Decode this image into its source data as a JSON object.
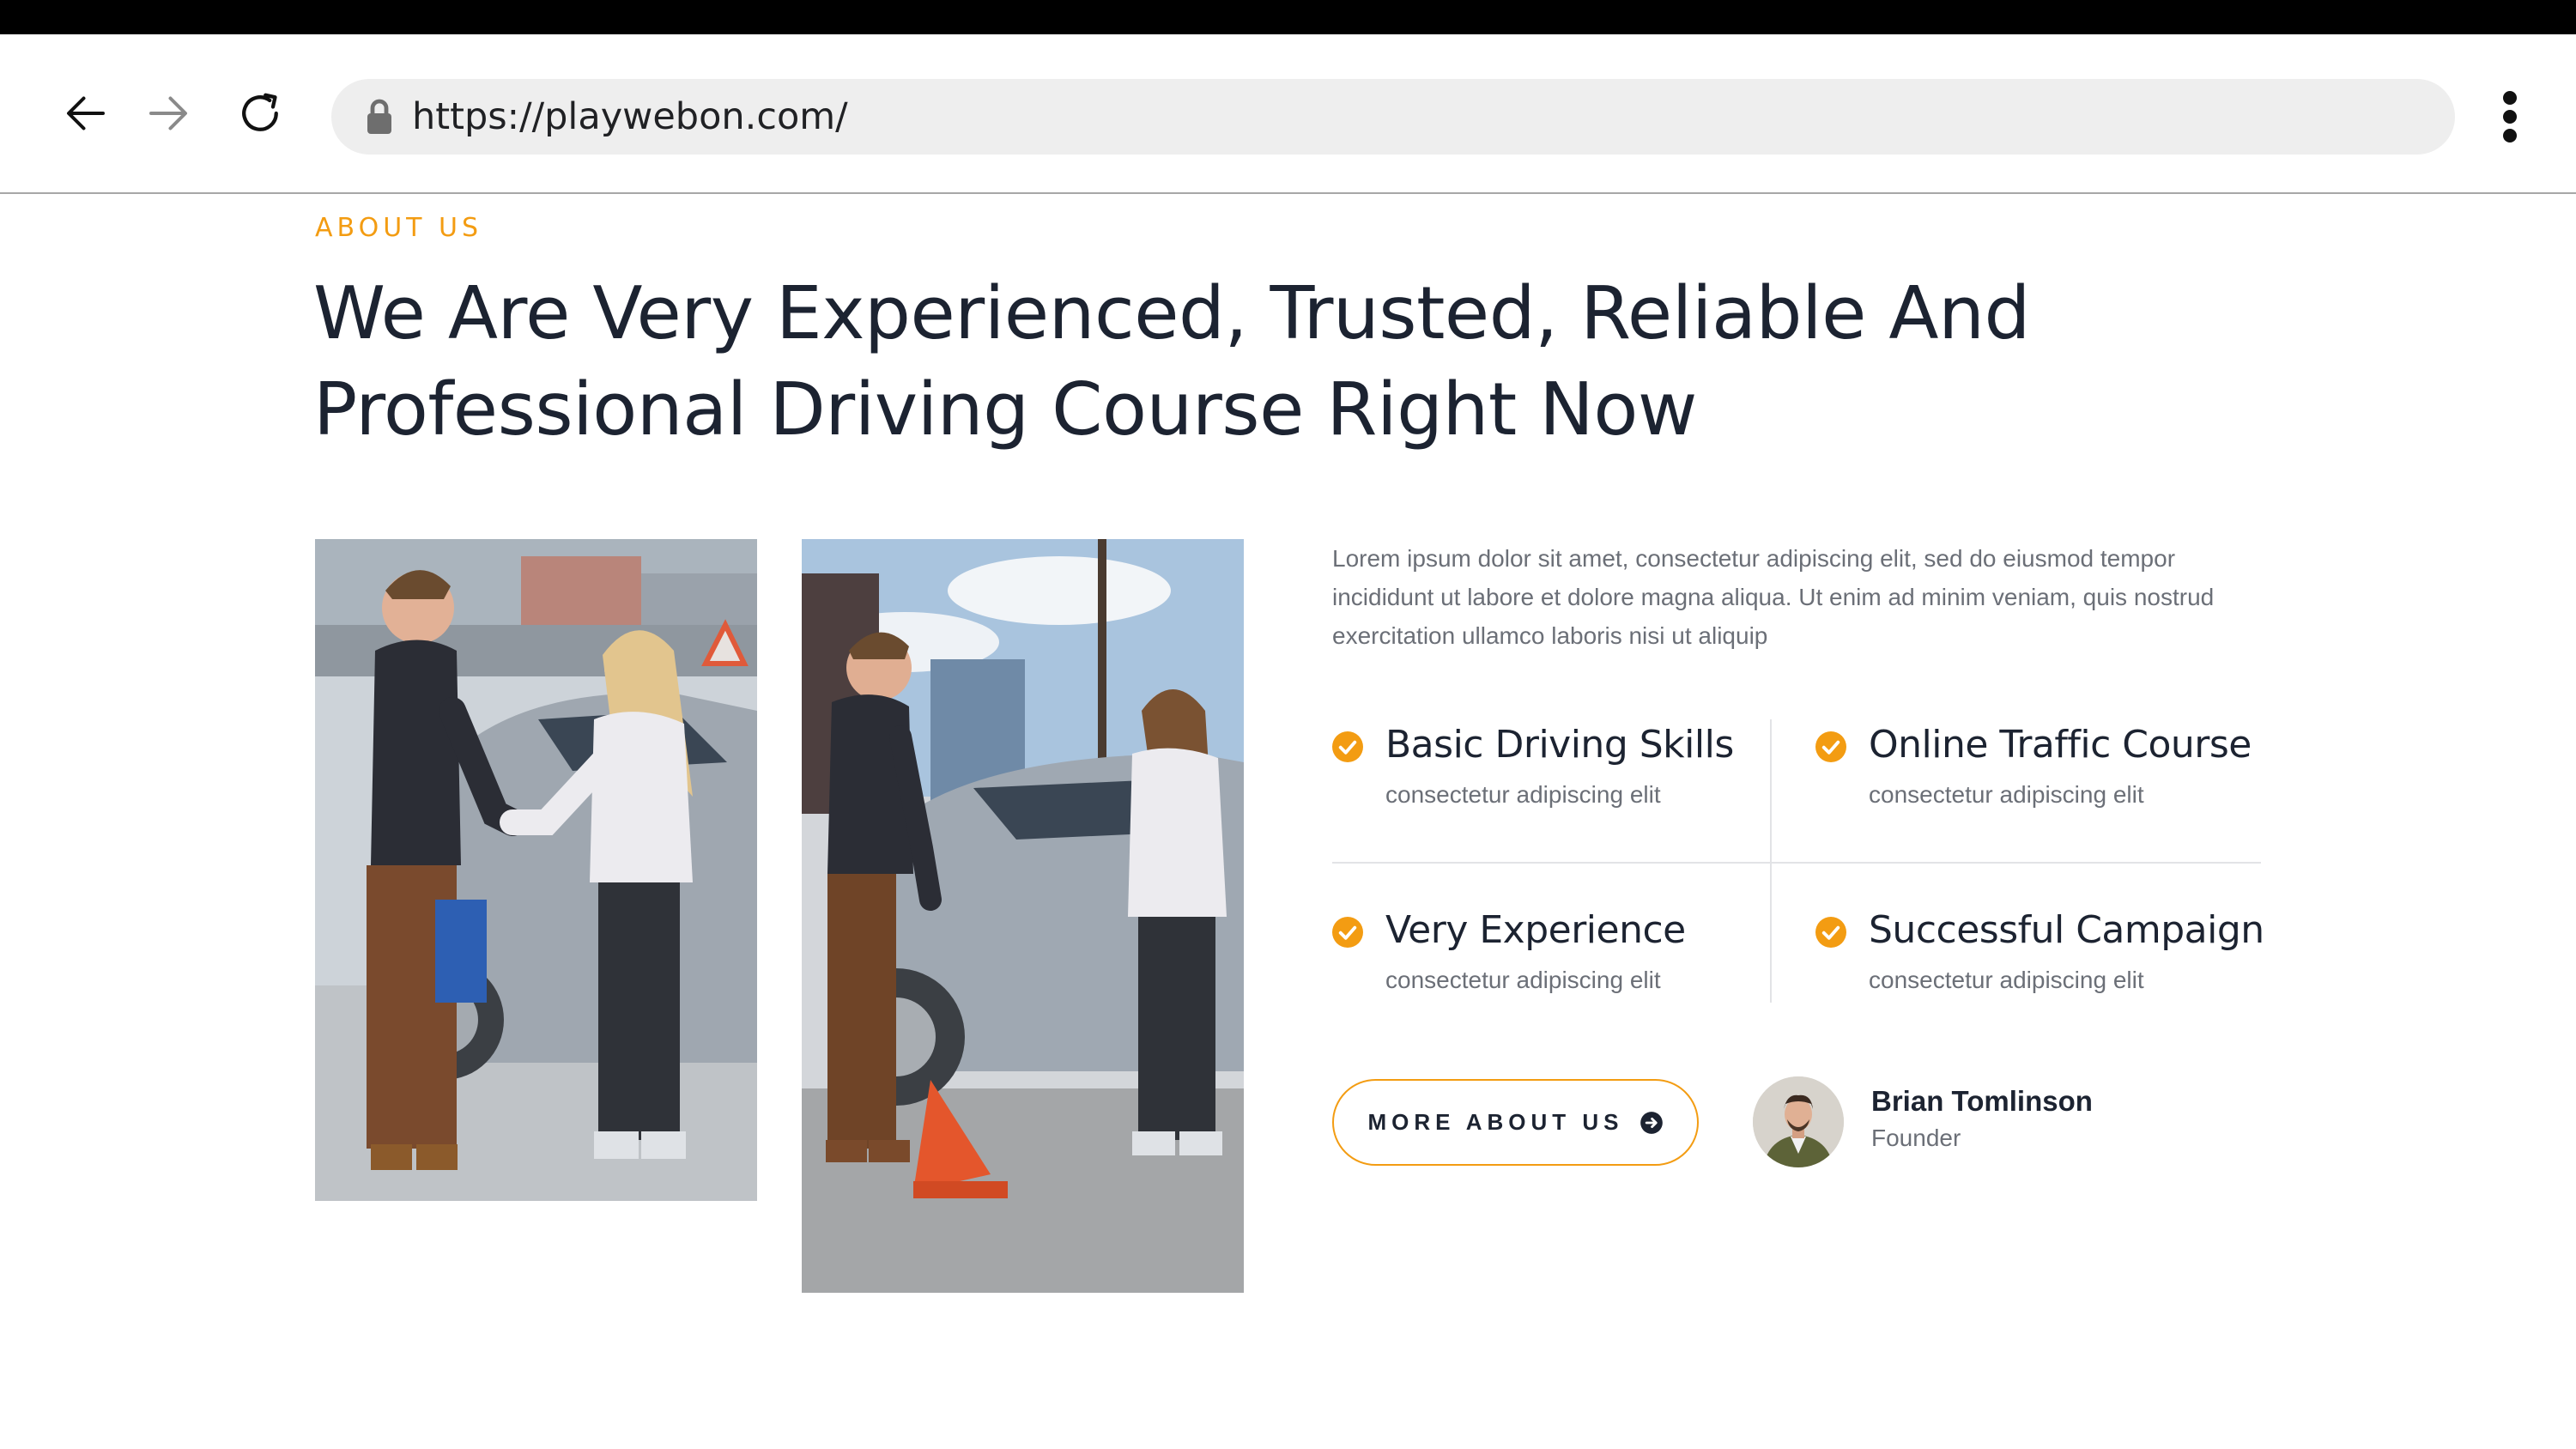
{
  "browser": {
    "url": "https://playwebon.com/",
    "icons": [
      "back-arrow-icon",
      "forward-arrow-icon",
      "reload-icon",
      "lock-icon",
      "more-vert-icon"
    ]
  },
  "about": {
    "eyebrow": "ABOUT US",
    "headline_line1": "We Are Very Experienced, Trusted, Reliable And",
    "headline_line2": "Professional Driving Course Right Now",
    "intro": "Lorem ipsum dolor sit amet, consectetur adipiscing elit, sed do eiusmod tempor incididunt ut labore et dolore magna aliqua. Ut enim ad minim veniam, quis nostrud exercitation ullamco laboris nisi ut aliquip",
    "features": [
      {
        "title": "Basic Driving Skills",
        "subtitle": "consectetur adipiscing elit"
      },
      {
        "title": "Online Traffic Course",
        "subtitle": "consectetur adipiscing elit"
      },
      {
        "title": "Very Experience",
        "subtitle": "consectetur adipiscing elit"
      },
      {
        "title": "Successful Campaign",
        "subtitle": "consectetur adipiscing elit"
      }
    ],
    "cta_label": "MORE ABOUT US",
    "person": {
      "name": "Brian Tomlinson",
      "role": "Founder"
    }
  },
  "colors": {
    "accent": "#f39c12",
    "heading": "#1c2331",
    "body_text": "#6b6f77",
    "divider": "#e2e3e6"
  }
}
